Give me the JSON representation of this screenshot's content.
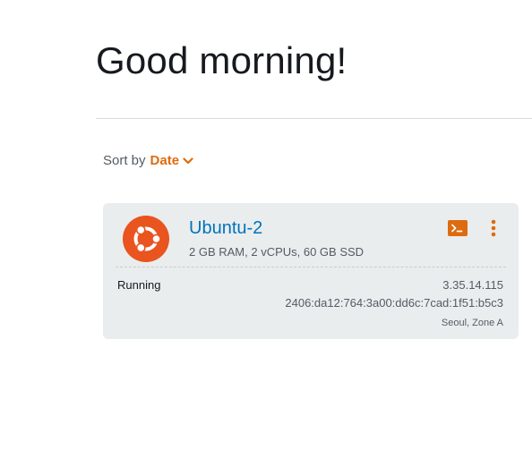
{
  "greeting": "Good morning!",
  "sort": {
    "label": "Sort by",
    "value": "Date",
    "icon": "chevron-down-icon"
  },
  "colors": {
    "accent": "#dd6b10",
    "link": "#0073bb",
    "card_bg": "#eaeded",
    "os_logo": "#e9541f"
  },
  "instances": [
    {
      "name": "Ubuntu-2",
      "specs": "2 GB RAM, 2 vCPUs, 60 GB SSD",
      "status": "Running",
      "ipv4": "3.35.14.115",
      "ipv6": "2406:da12:764:3a00:dd6c:7cad:1f51:b5c3",
      "region": "Seoul, Zone A",
      "os_icon": "ubuntu-logo-icon",
      "actions": [
        "terminal-icon",
        "more-vertical-icon"
      ]
    }
  ]
}
